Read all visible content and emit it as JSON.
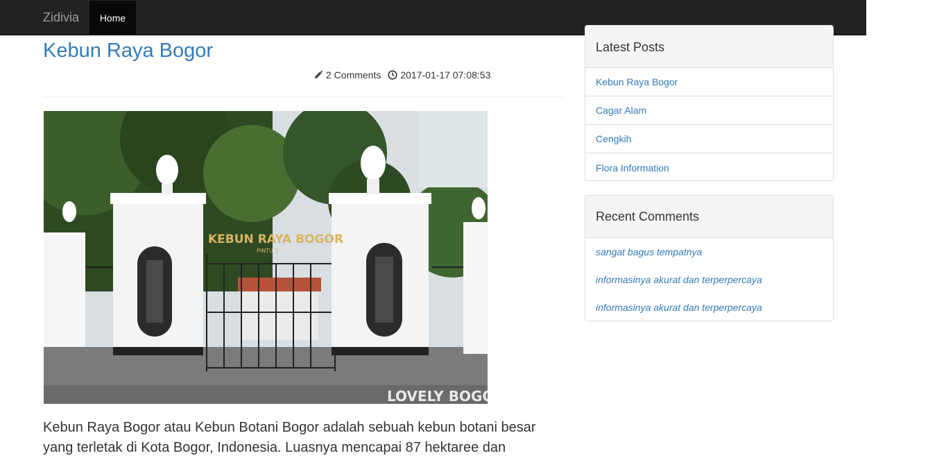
{
  "navbar": {
    "brand": "Zidivia",
    "home_label": "Home"
  },
  "post": {
    "title": "Kebun Raya Bogor",
    "comments": "2 Comments",
    "date": "2017-01-17 07:08:53",
    "image_sign": "KEBUN RAYA BOGOR",
    "image_sub": "PINTU 1",
    "image_watermark": "LOVELY BOGOR",
    "body": "Kebun Raya Bogor atau Kebun Botani Bogor adalah sebuah kebun botani besar yang terletak di Kota Bogor, Indonesia. Luasnya mencapai 87 hektaree dan"
  },
  "sidebar": {
    "latest_posts": {
      "heading": "Latest Posts",
      "items": [
        "Kebun Raya Bogor",
        "Cagar Alam",
        "Cengkih",
        "Flora Information"
      ]
    },
    "recent_comments": {
      "heading": "Recent Comments",
      "items": [
        "sangat bagus tempatnya",
        "informasinya akurat dan terperpercaya",
        "informasinya akurat dan terperpercaya"
      ]
    }
  }
}
